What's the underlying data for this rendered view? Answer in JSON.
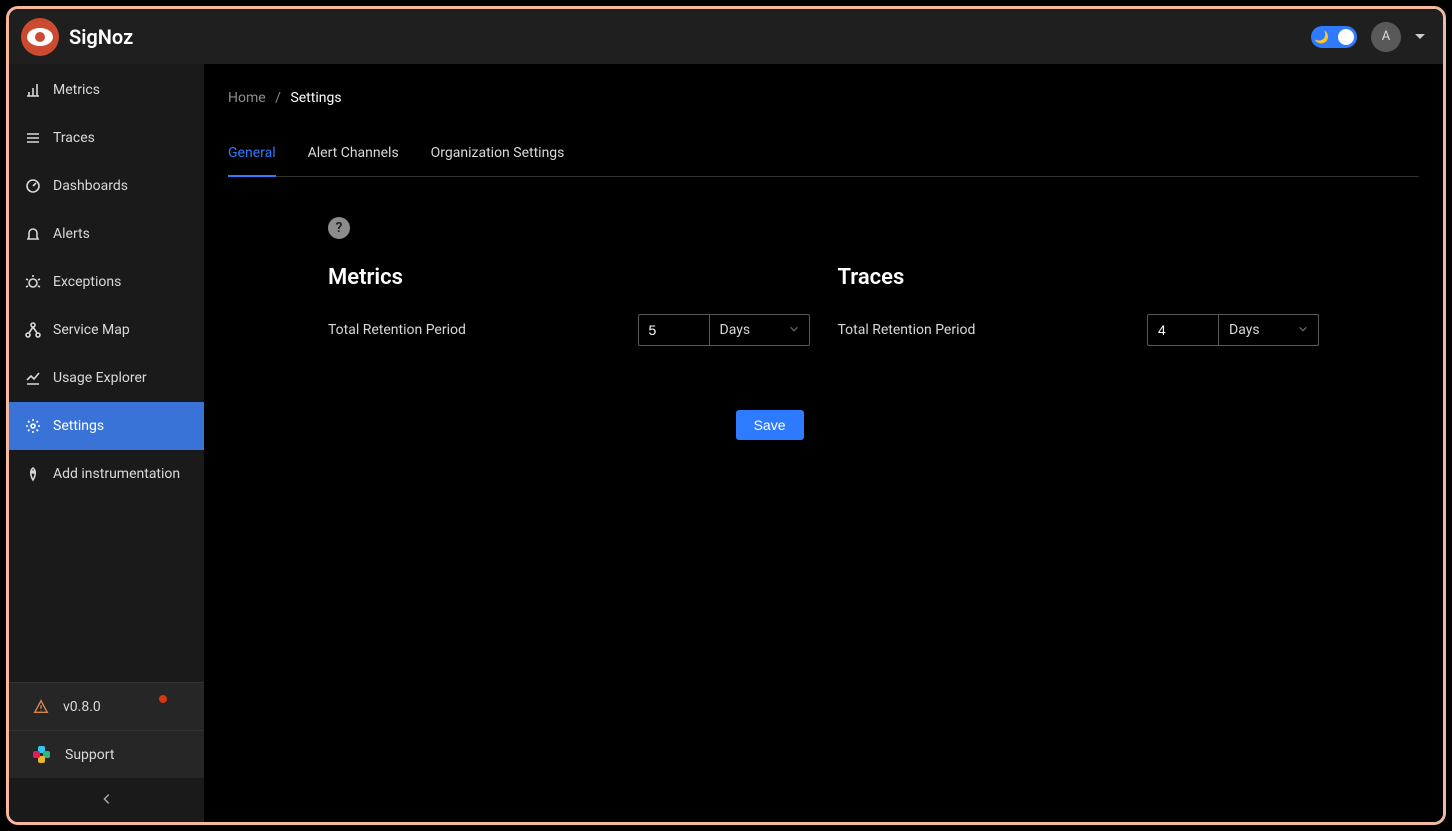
{
  "app": {
    "title": "SigNoz",
    "avatar_initial": "A"
  },
  "sidebar": {
    "items": [
      {
        "label": "Metrics"
      },
      {
        "label": "Traces"
      },
      {
        "label": "Dashboards"
      },
      {
        "label": "Alerts"
      },
      {
        "label": "Exceptions"
      },
      {
        "label": "Service Map"
      },
      {
        "label": "Usage Explorer"
      },
      {
        "label": "Settings"
      },
      {
        "label": "Add instrumentation"
      }
    ],
    "version_label": "v0.8.0",
    "support_label": "Support"
  },
  "breadcrumb": {
    "home": "Home",
    "current": "Settings"
  },
  "tabs": {
    "general": "General",
    "alert_channels": "Alert Channels",
    "org_settings": "Organization Settings"
  },
  "settings": {
    "metrics": {
      "title": "Metrics",
      "retention_label": "Total Retention Period",
      "retention_value": "5",
      "retention_unit": "Days"
    },
    "traces": {
      "title": "Traces",
      "retention_label": "Total Retention Period",
      "retention_value": "4",
      "retention_unit": "Days"
    },
    "save_label": "Save"
  }
}
